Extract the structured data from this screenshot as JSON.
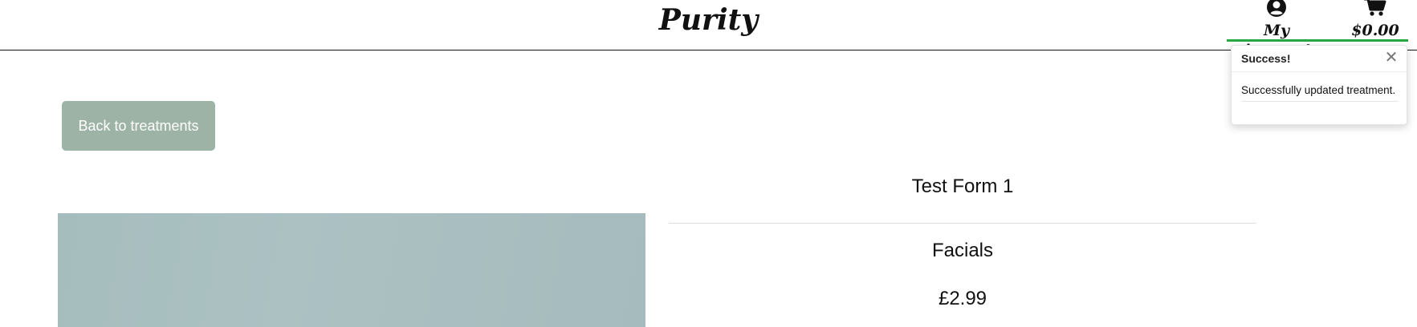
{
  "header": {
    "brand": "Purity",
    "account_label": "My Account",
    "cart_total": "$0.00",
    "account_icon": "user-circle-icon",
    "cart_icon": "shopping-cart-icon",
    "accent_color": "#28a745"
  },
  "toast": {
    "title": "Success!",
    "close_glyph": "✕",
    "message": "Successfully updated treatment."
  },
  "main": {
    "back_button_label": "Back to treatments",
    "back_button_color": "#9db3a6",
    "treatment": {
      "name": "Test Form 1",
      "category": "Facials",
      "price": "£2.99"
    }
  }
}
